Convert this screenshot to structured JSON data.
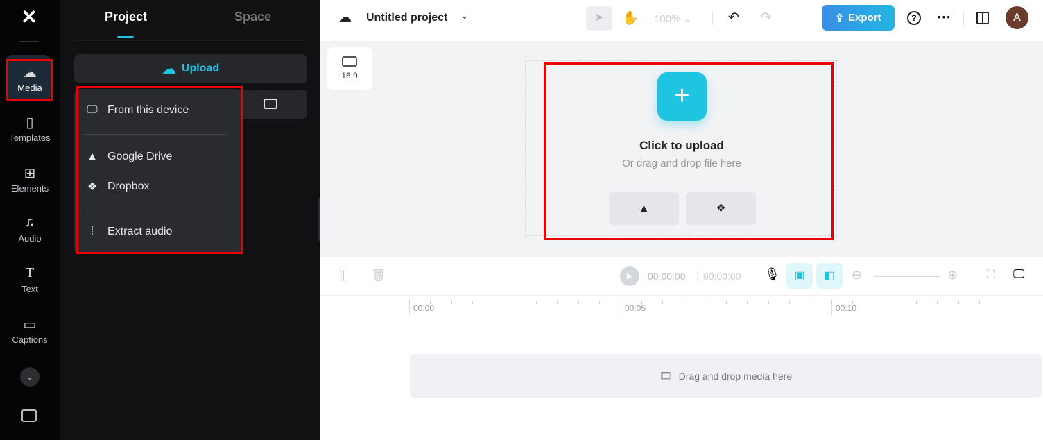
{
  "rail": {
    "items": [
      {
        "label": "Media",
        "icon": "cloud-upload-icon"
      },
      {
        "label": "Templates",
        "icon": "templates-icon"
      },
      {
        "label": "Elements",
        "icon": "elements-icon"
      },
      {
        "label": "Audio",
        "icon": "music-icon"
      },
      {
        "label": "Text",
        "icon": "text-icon"
      },
      {
        "label": "Captions",
        "icon": "captions-icon"
      }
    ]
  },
  "panel": {
    "tabs": [
      "Project",
      "Space"
    ],
    "upload_label": "Upload",
    "menu": [
      "From this device",
      "Google Drive",
      "Dropbox",
      "Extract audio"
    ]
  },
  "toolbar": {
    "project_title": "Untitled project",
    "zoom": "100%",
    "export_label": "Export",
    "avatar_letter": "A"
  },
  "canvas": {
    "ratio": "16:9",
    "upload_title": "Click to upload",
    "upload_sub": "Or drag and drop file here"
  },
  "timeline": {
    "current_time": "00:00:00",
    "total_time": "00:00:00",
    "ticks": [
      "00:00",
      "00:05",
      "00:10"
    ],
    "drop_label": "Drag and drop media here"
  },
  "colors": {
    "accent": "#1fc4e0",
    "export": "#3a8ee6",
    "annotation": "#e00000"
  }
}
